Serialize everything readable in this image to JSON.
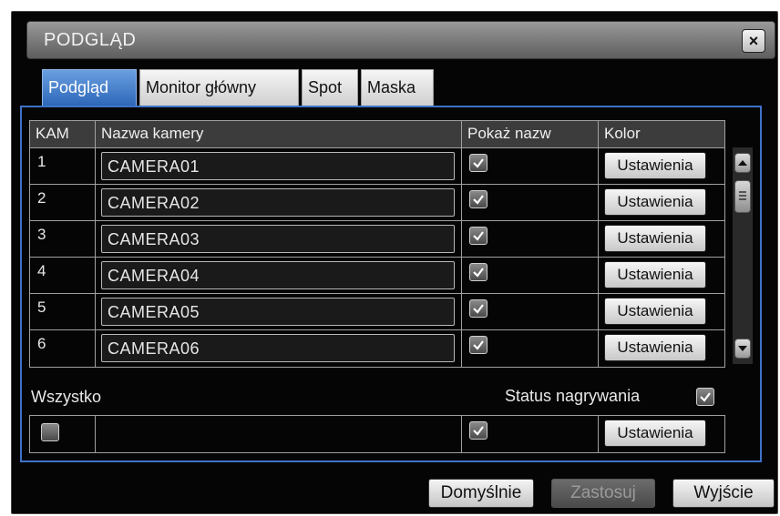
{
  "window": {
    "title": "PODGLĄD",
    "close_label": "×"
  },
  "tabs": [
    {
      "label": "Podgląd",
      "active": true
    },
    {
      "label": "Monitor główny",
      "active": false
    },
    {
      "label": "Spot",
      "active": false
    },
    {
      "label": "Maska",
      "active": false
    }
  ],
  "table": {
    "headers": {
      "kam": "KAM",
      "name": "Nazwa kamery",
      "show": "Pokaż nazw",
      "color": "Kolor"
    },
    "rows": [
      {
        "kam": "1",
        "name": "CAMERA01",
        "show": true,
        "button": "Ustawienia"
      },
      {
        "kam": "2",
        "name": "CAMERA02",
        "show": true,
        "button": "Ustawienia"
      },
      {
        "kam": "3",
        "name": "CAMERA03",
        "show": true,
        "button": "Ustawienia"
      },
      {
        "kam": "4",
        "name": "CAMERA04",
        "show": true,
        "button": "Ustawienia"
      },
      {
        "kam": "5",
        "name": "CAMERA05",
        "show": true,
        "button": "Ustawienia"
      },
      {
        "kam": "6",
        "name": "CAMERA06",
        "show": true,
        "button": "Ustawienia"
      }
    ]
  },
  "all": {
    "label": "Wszystko",
    "status_label": "Status nagrywania",
    "status_checked": true,
    "select_all_checked": false,
    "show_checked": true,
    "button": "Ustawienia"
  },
  "footer": {
    "default": "Domyślnie",
    "apply": "Zastosuj",
    "exit": "Wyjście"
  },
  "colors": {
    "accent": "#3e73c8",
    "background": "#050505"
  }
}
